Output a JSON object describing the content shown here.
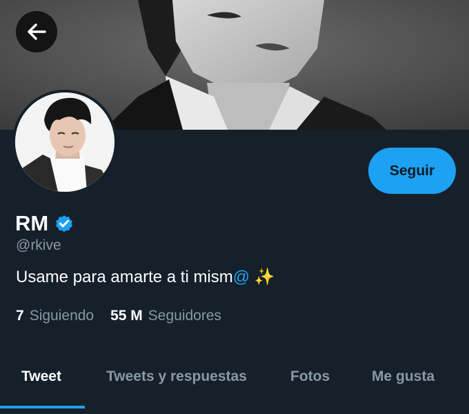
{
  "header": {
    "back_icon": "arrow-left-icon"
  },
  "profile": {
    "name": "RM",
    "verified_icon": "verified-badge-icon",
    "handle": "@rkive",
    "bio_main": "Usame para amarte a ti mism",
    "bio_at": "@",
    "bio_emoji": "✨",
    "follow_label": "Seguir"
  },
  "stats": {
    "following_count": "7",
    "following_label": "Siguiendo",
    "followers_count": "55 M",
    "followers_label": "Seguidores"
  },
  "tabs": [
    {
      "label": "Tweet",
      "active": true
    },
    {
      "label": "Tweets y respuestas",
      "active": false
    },
    {
      "label": "Fotos",
      "active": false
    },
    {
      "label": "Me gusta",
      "active": false
    }
  ],
  "colors": {
    "background": "#15202b",
    "accent": "#1da1f2",
    "muted_text": "#8899a6"
  }
}
